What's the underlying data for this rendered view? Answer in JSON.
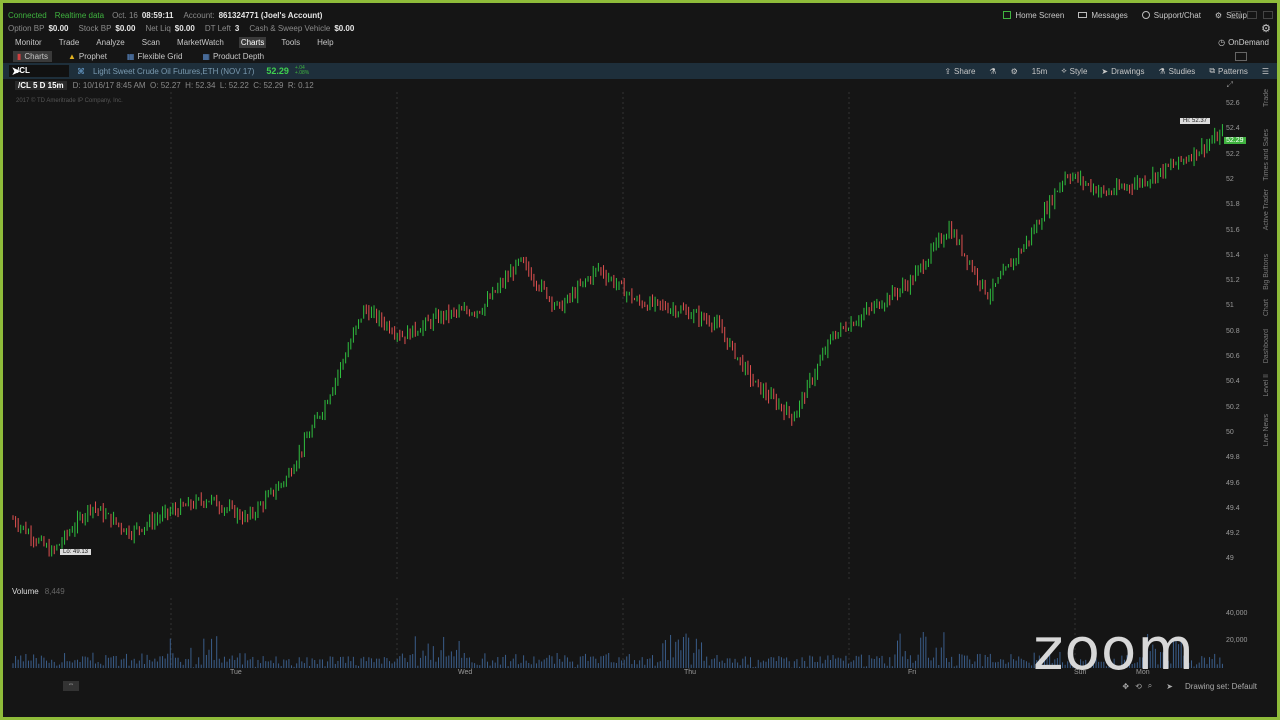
{
  "status": {
    "connected": "Connected",
    "data_type": "Realtime data",
    "date": "Oct. 16",
    "time": "08:59:11",
    "account_label": "Account:",
    "account": "861324771 (Joel's Account)"
  },
  "home_screen": "Home Screen",
  "messages": "Messages",
  "support": "Support/Chat",
  "setup": "Setup",
  "account_bar": [
    {
      "label": "Option BP",
      "value": "$0.00"
    },
    {
      "label": "Stock BP",
      "value": "$0.00"
    },
    {
      "label": "Net Liq",
      "value": "$0.00"
    },
    {
      "label": "DT Left",
      "value": "3"
    },
    {
      "label": "Cash & Sweep Vehicle",
      "value": "$0.00"
    }
  ],
  "menu": [
    "Monitor",
    "Trade",
    "Analyze",
    "Scan",
    "MarketWatch",
    "Charts",
    "Tools",
    "Help"
  ],
  "menu_active": "Charts",
  "ondemand": "OnDemand",
  "subtabs": [
    "Charts",
    "Prophet",
    "Flexible Grid",
    "Product Depth"
  ],
  "symbol": {
    "ticker": "/CL",
    "description": "Light Sweet Crude Oil Futures,ETH (NOV 17)",
    "last": "52.29",
    "change": "+.04\n+.08%"
  },
  "chart_tools": {
    "share": "Share",
    "timeframe": "15m",
    "style": "Style",
    "drawings": "Drawings",
    "studies": "Studies",
    "patterns": "Patterns"
  },
  "legend": {
    "title": "/CL 5 D 15m",
    "ohlc": "D: 10/16/17 8:45 AM  O: 52.27  H: 52.34  L: 52.22  C: 52.29  R: 0.12"
  },
  "copyright": "2017 © TD Ameritrade IP Company, Inc.",
  "hi_label": "Hi: 52.37",
  "lo_label": "Lo: 49.13",
  "price_tag": "52.29",
  "volume_label": "Volume",
  "volume_value": "8,449",
  "price_ticks": [
    "52.6",
    "52.4",
    "52.2",
    "52",
    "51.8",
    "51.6",
    "51.4",
    "51.2",
    "51",
    "50.8",
    "50.6",
    "50.4",
    "50.2",
    "50",
    "49.8",
    "49.6",
    "49.4",
    "49.2",
    "49"
  ],
  "volume_ticks": [
    "40,000",
    "20,000"
  ],
  "x_ticks": [
    "Tue",
    "Wed",
    "Thu",
    "Fri",
    "Sun",
    "Mon"
  ],
  "sidebar": [
    "Trade",
    "Times and Sales",
    "Active Trader",
    "Big Buttons",
    "Chart",
    "Dashboard",
    "Level II",
    "Live News"
  ],
  "drawing_set": "Drawing set: Default",
  "zoom": "zoom",
  "chart_data": {
    "type": "line",
    "title": "/CL 5 D 15m",
    "ylim": [
      49.0,
      52.6
    ],
    "x": [
      "Mon",
      "Tue",
      "Wed",
      "Thu",
      "Fri",
      "Sun",
      "Mon"
    ],
    "series": [
      {
        "values": [
          49.45,
          49.2,
          49.55,
          49.35,
          49.5,
          49.6,
          49.45,
          49.75,
          50.3,
          51.0,
          50.8,
          50.95,
          51.0,
          51.35,
          51.0,
          51.3,
          51.05,
          51.0,
          50.9,
          50.45,
          50.2,
          50.8,
          51.0,
          51.2,
          51.6,
          51.1,
          51.5,
          52.0,
          51.85,
          51.95,
          52.1,
          52.29
        ]
      }
    ],
    "volume_ylim": [
      0,
      45000
    ],
    "grid": true
  }
}
